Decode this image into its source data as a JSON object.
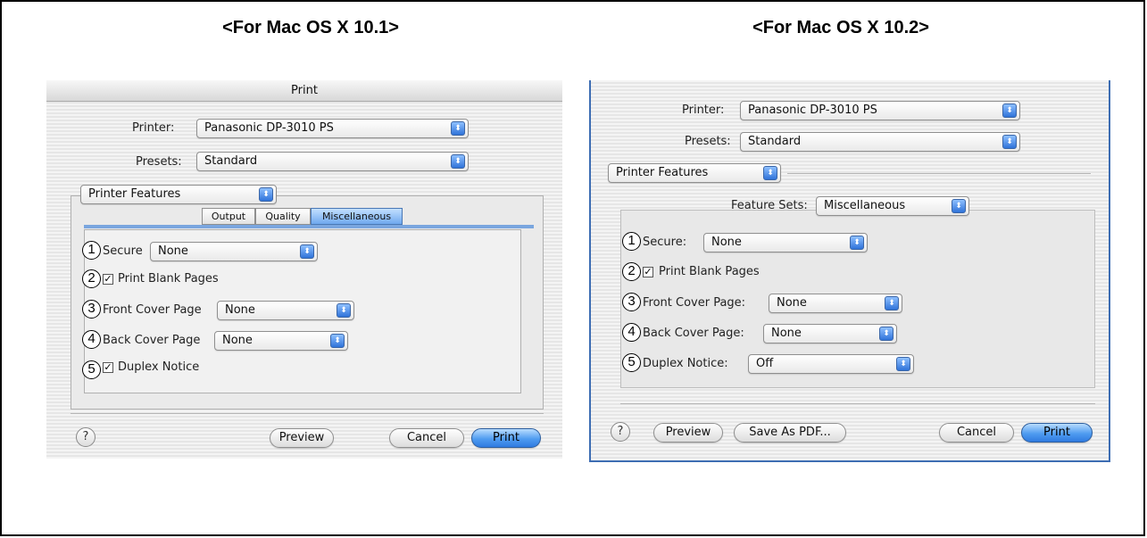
{
  "headings": {
    "left": "<For Mac OS X 10.1>",
    "right": "<For Mac OS X 10.2>"
  },
  "left_dialog": {
    "title": "Print",
    "printer_label": "Printer:",
    "printer_value": "Panasonic DP-3010 PS",
    "presets_label": "Presets:",
    "presets_value": "Standard",
    "panel_value": "Printer Features",
    "tabs": [
      "Output",
      "Quality",
      "Miscellaneous"
    ],
    "active_tab": "Miscellaneous",
    "secure_label": "Secure",
    "secure_value": "None",
    "print_blank_pages_label": "Print Blank Pages",
    "print_blank_pages_checked": true,
    "front_cover_label": "Front Cover Page",
    "front_cover_value": "None",
    "back_cover_label": "Back Cover Page",
    "back_cover_value": "None",
    "duplex_notice_label": "Duplex Notice",
    "duplex_notice_checked": true,
    "help_label": "?",
    "preview_label": "Preview",
    "cancel_label": "Cancel",
    "print_label": "Print"
  },
  "right_dialog": {
    "printer_label": "Printer:",
    "printer_value": "Panasonic DP-3010 PS",
    "presets_label": "Presets:",
    "presets_value": "Standard",
    "panel_value": "Printer Features",
    "feature_sets_label": "Feature Sets:",
    "feature_sets_value": "Miscellaneous",
    "secure_label": "Secure:",
    "secure_value": "None",
    "print_blank_pages_label": "Print Blank Pages",
    "print_blank_pages_checked": true,
    "front_cover_label": "Front Cover Page:",
    "front_cover_value": "None",
    "back_cover_label": "Back Cover Page:",
    "back_cover_value": "None",
    "duplex_notice_label": "Duplex Notice:",
    "duplex_notice_value": "Off",
    "help_label": "?",
    "preview_label": "Preview",
    "save_pdf_label": "Save As PDF...",
    "cancel_label": "Cancel",
    "print_label": "Print"
  },
  "callouts": [
    "1",
    "2",
    "3",
    "4",
    "5"
  ],
  "glyphs": {
    "popup_arrow": "⬍",
    "check_mark": "✓"
  },
  "colors": {
    "accent_blue": "#2f7ae0",
    "window_bg": "#ececec"
  }
}
